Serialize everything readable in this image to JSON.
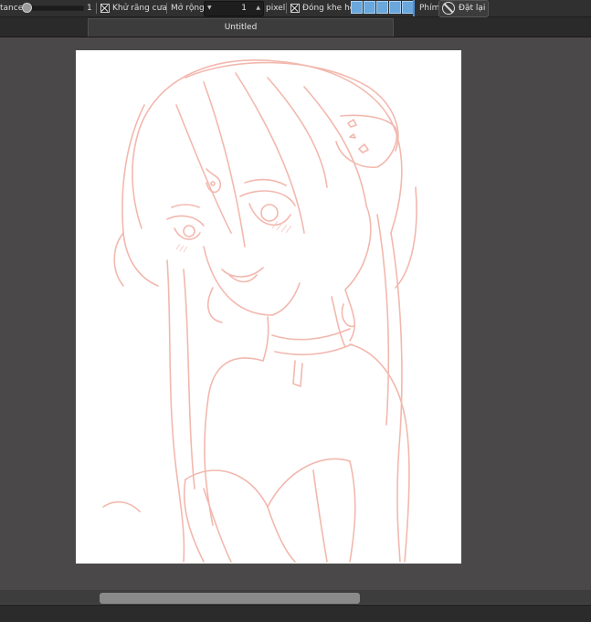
{
  "toolbar": {
    "tolerance_label": "tance",
    "tolerance_value": "1",
    "anti_alias_label": "Khử răng cưa",
    "expand_label": "Mở rộng",
    "expand_value": "1",
    "expand_unit": "pixel",
    "close_gap_label": "Đóng khe hở",
    "close_gap_level_count": 5,
    "shortcut_label": "Phím",
    "reset_label": "Đặt lại",
    "accent_color": "#6aa7dc"
  },
  "tabs": [
    {
      "label": "Untitled"
    }
  ],
  "canvas": {
    "paper_color": "#ffffff",
    "sketch_color": "#f2b8ae",
    "content": "pink line sketch of an anime girl"
  }
}
